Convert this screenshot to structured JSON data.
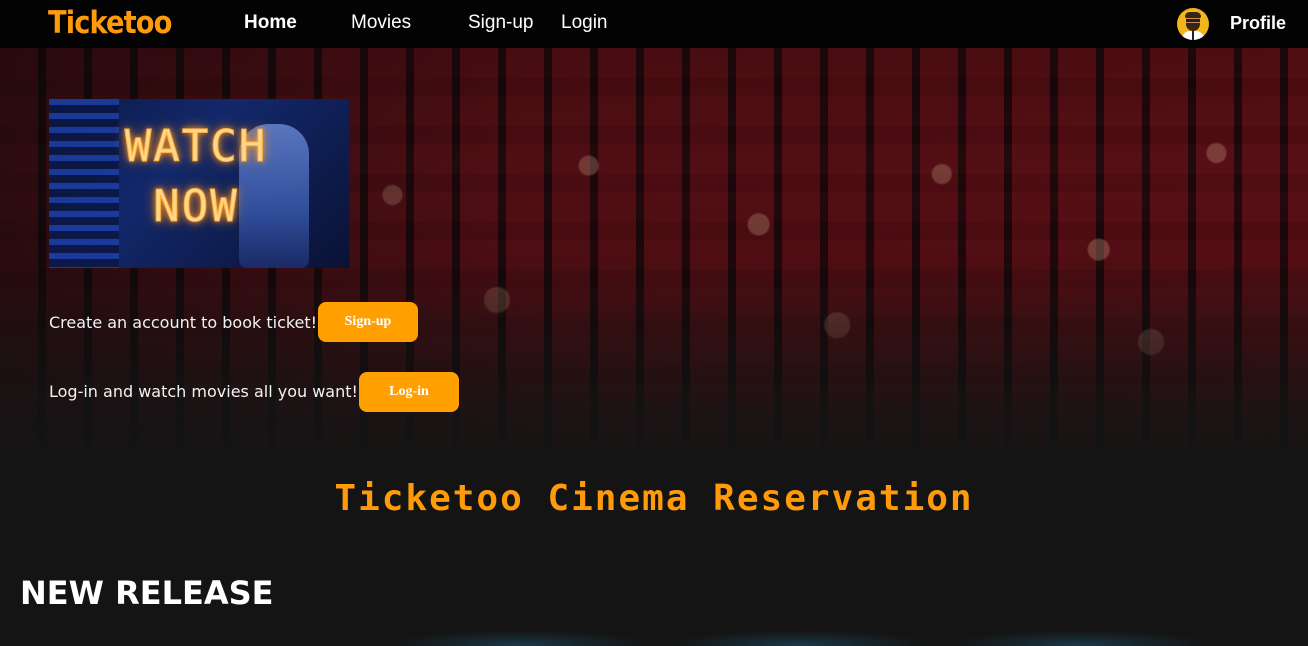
{
  "navbar": {
    "brand": "Ticketoo",
    "links": {
      "home": "Home",
      "movies": "Movies",
      "signup": "Sign-up",
      "login": "Login"
    },
    "profile_label": "Profile",
    "avatar_icon": "user-avatar-icon"
  },
  "hero": {
    "banner": {
      "line1": "WATCH",
      "line2": "NOW"
    },
    "cta_signup_text": "Create an account to book ticket!",
    "cta_signup_button": "Sign-up",
    "cta_login_text": "Log-in and watch movies all you want!",
    "cta_login_button": "Log-in"
  },
  "main": {
    "title": "Ticketoo Cinema Reservation",
    "new_release_heading": "NEW RELEASE"
  },
  "colors": {
    "accent": "#ff9f00",
    "brand": "#ff9a0a",
    "navbar_bg": "#030303",
    "page_bg": "#141414"
  }
}
